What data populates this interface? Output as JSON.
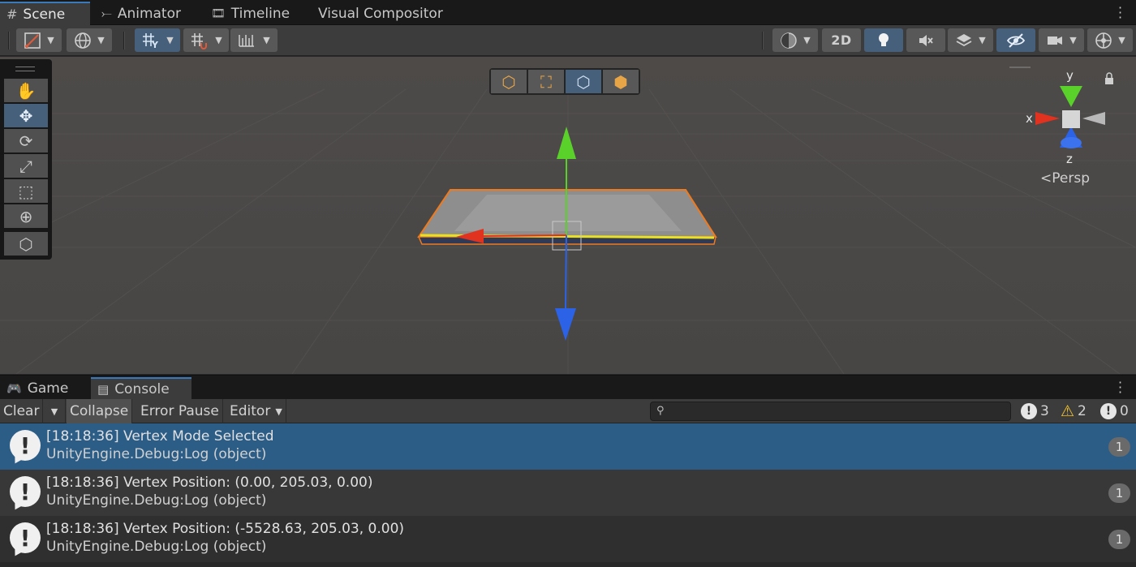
{
  "tabs": [
    {
      "icon": "#",
      "label": "Scene",
      "active": true
    },
    {
      "icon": "⤚",
      "label": "Animator",
      "active": false
    },
    {
      "icon": "🎞",
      "label": "Timeline",
      "active": false
    },
    {
      "icon": "",
      "label": "Visual Compositor",
      "active": false
    }
  ],
  "toolbar": {
    "mode_2d_label": "2D"
  },
  "scene": {
    "gizmo": {
      "x_label": "x",
      "y_label": "y",
      "z_label": "z"
    },
    "projection_label": "Persp"
  },
  "bottom_tabs": [
    {
      "label": "Game",
      "active": false
    },
    {
      "label": "Console",
      "active": true
    }
  ],
  "console": {
    "clear_label": "Clear",
    "collapse_label": "Collapse",
    "error_pause_label": "Error Pause",
    "editor_label": "Editor",
    "search_placeholder": "",
    "counts": {
      "info": "3",
      "warning": "2",
      "error": "0"
    },
    "entries": [
      {
        "line1": "[18:18:36] Vertex Mode Selected",
        "line2": "UnityEngine.Debug:Log (object)",
        "count": "1",
        "selected": true
      },
      {
        "line1": "[18:18:36] Vertex Position: (0.00, 205.03, 0.00)",
        "line2": "UnityEngine.Debug:Log (object)",
        "count": "1",
        "selected": false
      },
      {
        "line1": "[18:18:36] Vertex Position: (-5528.63, 205.03, 0.00)",
        "line2": "UnityEngine.Debug:Log (object)",
        "count": "1",
        "selected": false
      }
    ]
  },
  "colors": {
    "accent": "#3a79bb",
    "selected_row": "#2c5d87",
    "x_axis": "#e0321e",
    "y_axis": "#5ad12a",
    "z_axis": "#2c63e6",
    "selection_outline": "#f07a1c"
  }
}
